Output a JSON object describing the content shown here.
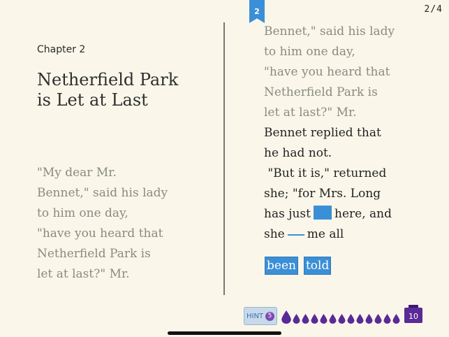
{
  "header": {
    "page_indicator": "2/4",
    "bookmark_number": "2"
  },
  "left_page": {
    "chapter_label": "Chapter 2",
    "title_lines": [
      "Netherfield Park",
      "is Let at Last"
    ],
    "paragraph_lines": [
      "\"My dear Mr.",
      "Bennet,\" said his lady",
      "to him one day,",
      "\"have you heard that",
      "Netherfield Park is",
      "let at last?\" Mr."
    ]
  },
  "right_page": {
    "faded_lines": [
      "Bennet,\" said his lady",
      "to him one day,",
      "\"have you heard that",
      "Netherfield Park is",
      "let at last?\" Mr."
    ],
    "dark_lines": [
      "Bennet replied that",
      "he had not.",
      " \"But it is,\" returned",
      "she; \"for Mrs. Long"
    ],
    "blank_line_1": {
      "before": "has just",
      "after": "here, and"
    },
    "blank_line_2": {
      "before": "she",
      "after": "me all"
    },
    "choices": [
      "been",
      "told"
    ]
  },
  "footer": {
    "hint_label": "HINT",
    "hint_count": "5",
    "ink_count": "10",
    "colors": {
      "accent": "#3b8fd6",
      "ink": "#5a2a96"
    }
  }
}
